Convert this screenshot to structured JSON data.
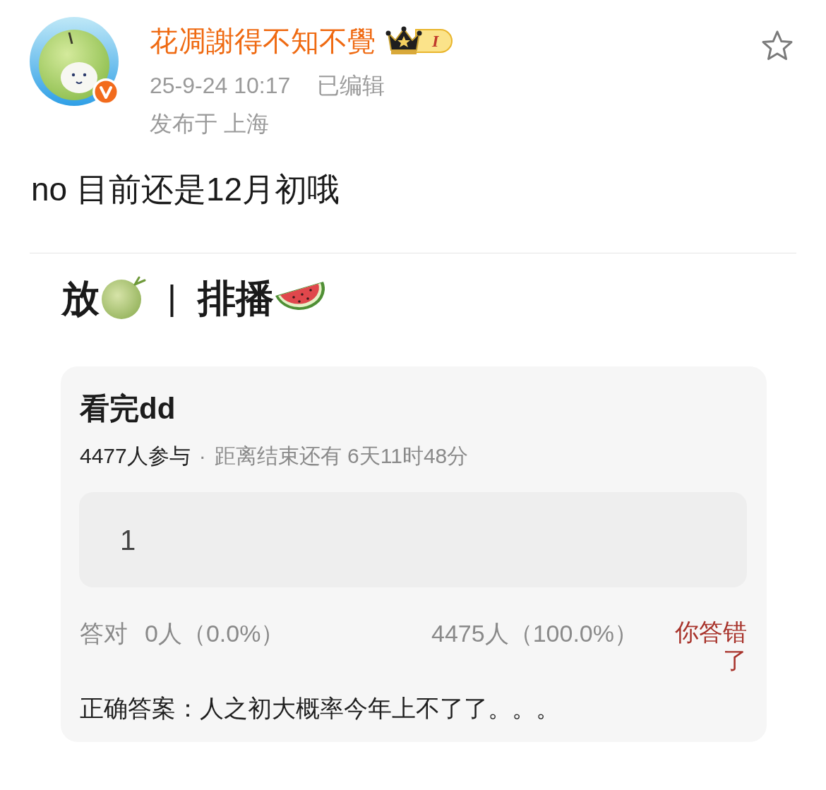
{
  "post": {
    "author": {
      "name": "花凋謝得不知不覺",
      "verified": true,
      "level_badge": "I"
    },
    "timestamp": "25-9-24 10:17",
    "edited": "已编辑",
    "location": "发布于 上海",
    "favorited": false,
    "text": "no 目前还是12月初哦"
  },
  "image": {
    "heading": {
      "left": "放",
      "separator": "|",
      "right": "排播"
    },
    "poll": {
      "title": "看完dd",
      "participants": "4477人参与",
      "separator": "·",
      "remaining": "距离结束还有 6天11时48分",
      "options": [
        {
          "text": "1"
        }
      ],
      "results": {
        "correct_label": "答对",
        "correct_count": "0人（0.0%）",
        "wrong_count": "4475人（100.0%）",
        "verdict": "你答错了"
      },
      "answer": "正确答案：人之初大概率今年上不了了。。。"
    }
  }
}
